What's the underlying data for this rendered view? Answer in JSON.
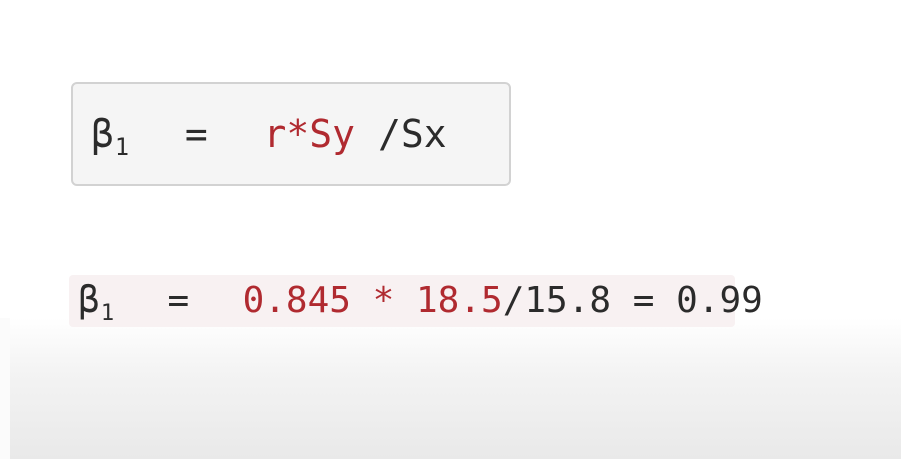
{
  "formula_general": {
    "beta": "β",
    "subscript": "1",
    "equals": "=",
    "numerator_expr": "r*Sy",
    "slash_expr": "/Sx"
  },
  "formula_numeric": {
    "beta": "β",
    "subscript": "1",
    "equals": "=",
    "r_value": "0.845",
    "times": "*",
    "sy_value": "18.5",
    "slash_sx": "/15.8",
    "equals_2": "=",
    "result": "0.99"
  },
  "colors": {
    "highlight_red": "#b02a30",
    "text_dark": "#2b2b2b",
    "box_background": "#f5f5f5",
    "box_border": "#d2d2d2",
    "inline_code_background": "#f8f1f2"
  }
}
